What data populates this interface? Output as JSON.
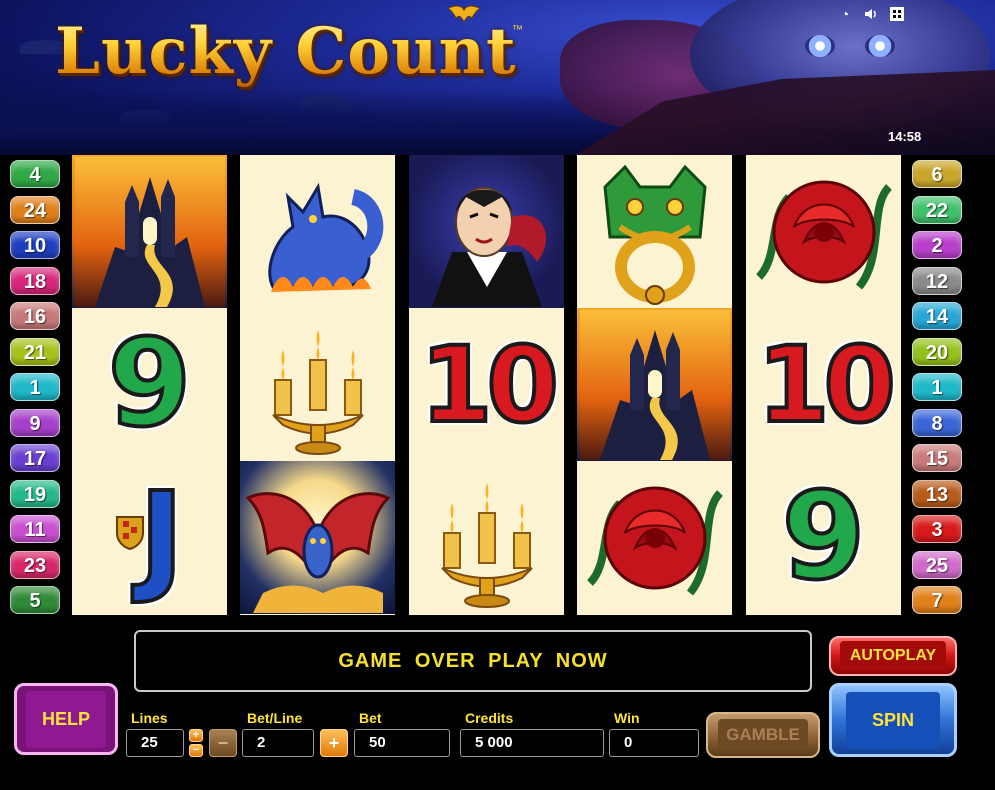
{
  "game": {
    "title": "Lucky Count",
    "trademark": "™",
    "clock": "14:58"
  },
  "top_icons": [
    {
      "name": "settings-icon",
      "glyph": "◔"
    },
    {
      "name": "sound-icon",
      "glyph": "◀)"
    },
    {
      "name": "fullscreen-icon",
      "glyph": "▣"
    }
  ],
  "reels": [
    [
      {
        "symbol": "castle"
      },
      {
        "symbol": "9",
        "color": "green"
      },
      {
        "symbol": "J",
        "color": "blue"
      }
    ],
    [
      {
        "symbol": "wolf"
      },
      {
        "symbol": "candelabra"
      },
      {
        "symbol": "bat"
      }
    ],
    [
      {
        "symbol": "count"
      },
      {
        "symbol": "10",
        "color": "red"
      },
      {
        "symbol": "candelabra"
      }
    ],
    [
      {
        "symbol": "door-knocker"
      },
      {
        "symbol": "castle"
      },
      {
        "symbol": "rose"
      }
    ],
    [
      {
        "symbol": "rose"
      },
      {
        "symbol": "10",
        "color": "red"
      },
      {
        "symbol": "9",
        "color": "green"
      }
    ]
  ],
  "paylines_left": [
    {
      "n": "4",
      "color": "#2fa845"
    },
    {
      "n": "24",
      "color": "#e0801a"
    },
    {
      "n": "10",
      "color": "#1f3fc2"
    },
    {
      "n": "18",
      "color": "#d8267a"
    },
    {
      "n": "16",
      "color": "#c7787a"
    },
    {
      "n": "21",
      "color": "#a8c21a"
    },
    {
      "n": "1",
      "color": "#1fb8c9"
    },
    {
      "n": "9",
      "color": "#a63fc9"
    },
    {
      "n": "17",
      "color": "#6a3fd1"
    },
    {
      "n": "19",
      "color": "#25b88a"
    },
    {
      "n": "11",
      "color": "#c94fd1"
    },
    {
      "n": "23",
      "color": "#d8266a"
    },
    {
      "n": "5",
      "color": "#2f8a38"
    }
  ],
  "paylines_right": [
    {
      "n": "6",
      "color": "#c9a62a"
    },
    {
      "n": "22",
      "color": "#40c06a"
    },
    {
      "n": "2",
      "color": "#b73fc9"
    },
    {
      "n": "12",
      "color": "#8a8a8a"
    },
    {
      "n": "14",
      "color": "#27a6d6"
    },
    {
      "n": "20",
      "color": "#93c21a"
    },
    {
      "n": "1",
      "color": "#1fb8c9"
    },
    {
      "n": "8",
      "color": "#3a66d6"
    },
    {
      "n": "15",
      "color": "#c97a7a"
    },
    {
      "n": "13",
      "color": "#b85a1a"
    },
    {
      "n": "3",
      "color": "#d81a1a"
    },
    {
      "n": "25",
      "color": "#d06ac9"
    },
    {
      "n": "7",
      "color": "#e0801a"
    }
  ],
  "message": "GAME OVER  PLAY NOW",
  "buttons": {
    "help": "HELP",
    "autoplay": "AUTOPLAY",
    "spin": "SPIN",
    "gamble": "GAMBLE",
    "lines_up": "+",
    "lines_down": "−",
    "bet_minus": "−",
    "bet_plus": "+"
  },
  "fields": {
    "lines_label": "Lines",
    "lines_value": "25",
    "betline_label": "Bet/Line",
    "betline_value": "2",
    "bet_label": "Bet",
    "bet_value": "50",
    "credits_label": "Credits",
    "credits_value": "5 000",
    "win_label": "Win",
    "win_value": "0"
  }
}
